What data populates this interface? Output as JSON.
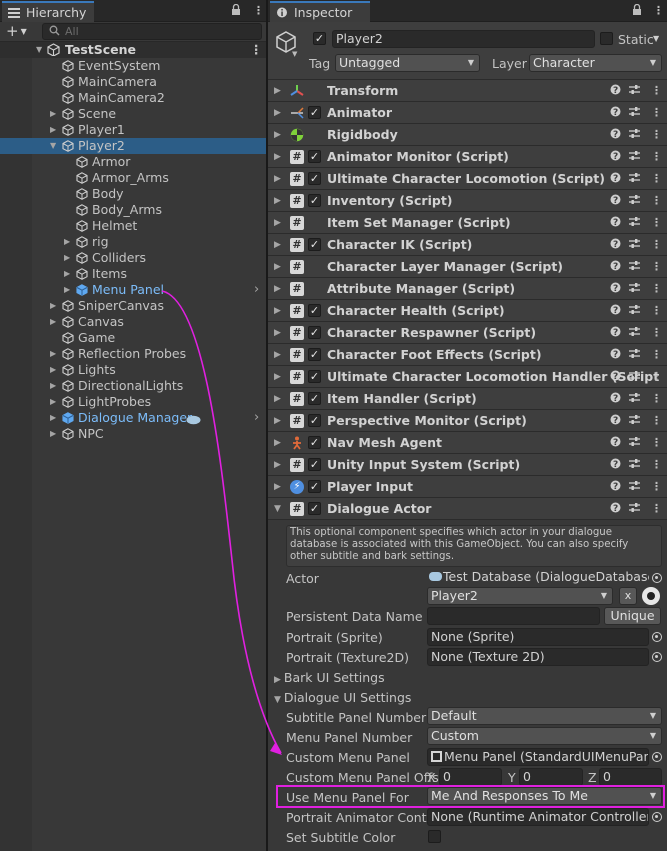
{
  "hierarchy": {
    "tab_title": "Hierarchy",
    "search_placeholder": "All",
    "scene": "TestScene",
    "items": [
      {
        "label": "EventSystem"
      },
      {
        "label": "MainCamera"
      },
      {
        "label": "MainCamera2"
      },
      {
        "label": "Scene"
      },
      {
        "label": "Player1"
      },
      {
        "label": "Player2"
      },
      {
        "label": "Armor"
      },
      {
        "label": "Armor_Arms"
      },
      {
        "label": "Body"
      },
      {
        "label": "Body_Arms"
      },
      {
        "label": "Helmet"
      },
      {
        "label": "rig"
      },
      {
        "label": "Colliders"
      },
      {
        "label": "Items"
      },
      {
        "label": "Menu Panel"
      },
      {
        "label": "SniperCanvas"
      },
      {
        "label": "Canvas"
      },
      {
        "label": "Game"
      },
      {
        "label": "Reflection Probes"
      },
      {
        "label": "Lights"
      },
      {
        "label": "DirectionalLights"
      },
      {
        "label": "LightProbes"
      },
      {
        "label": "Dialogue Manager"
      },
      {
        "label": "NPC"
      }
    ]
  },
  "inspector": {
    "tab_title": "Inspector",
    "object_name": "Player2",
    "static_label": "Static",
    "tag_label": "Tag",
    "tag_value": "Untagged",
    "layer_label": "Layer",
    "layer_value": "Character",
    "components": [
      {
        "name": "Transform",
        "icon": "transform-icon"
      },
      {
        "name": "Animator",
        "icon": "animator-icon"
      },
      {
        "name": "Rigidbody",
        "icon": "rigidbody-icon"
      },
      {
        "name": "Animator Monitor (Script)",
        "icon": "script-icon"
      },
      {
        "name": "Ultimate Character Locomotion (Script)",
        "icon": "script-icon"
      },
      {
        "name": "Inventory (Script)",
        "icon": "script-icon"
      },
      {
        "name": "Item Set Manager (Script)",
        "icon": "script-icon"
      },
      {
        "name": "Character IK (Script)",
        "icon": "script-icon"
      },
      {
        "name": "Character Layer Manager (Script)",
        "icon": "script-icon"
      },
      {
        "name": "Attribute Manager (Script)",
        "icon": "script-icon"
      },
      {
        "name": "Character Health (Script)",
        "icon": "script-icon"
      },
      {
        "name": "Character Respawner (Script)",
        "icon": "script-icon"
      },
      {
        "name": "Character Foot Effects (Script)",
        "icon": "script-icon"
      },
      {
        "name": "Ultimate Character Locomotion Handler (Script",
        "icon": "script-icon"
      },
      {
        "name": "Item Handler (Script)",
        "icon": "script-icon"
      },
      {
        "name": "Perspective Monitor (Script)",
        "icon": "script-icon"
      },
      {
        "name": "Nav Mesh Agent",
        "icon": "navmesh-icon"
      },
      {
        "name": "Unity Input System (Script)",
        "icon": "script-icon"
      },
      {
        "name": "Player Input",
        "icon": "player-input-icon"
      },
      {
        "name": "Dialogue Actor",
        "icon": "script-icon"
      }
    ],
    "dialogue_actor": {
      "help_text": "This optional component specifies which actor in your dialogue database is associated with this GameObject. You can also specify other subtitle and bark settings.",
      "actor_label": "Actor",
      "actor_db": "Test Database (DialogueDatabase)",
      "actor_value": "Player2",
      "clear_label": "x",
      "persistent_label": "Persistent Data Name",
      "persistent_value": "",
      "unique_label": "Unique",
      "portrait_sprite_label": "Portrait (Sprite)",
      "portrait_sprite_value": "None (Sprite)",
      "portrait_tex_label": "Portrait (Texture2D)",
      "portrait_tex_value": "None (Texture 2D)",
      "bark_label": "Bark UI Settings",
      "dialogue_ui_label": "Dialogue UI Settings",
      "subtitle_panel_label": "Subtitle Panel Number",
      "subtitle_panel_value": "Default",
      "menu_panel_label": "Menu Panel Number",
      "menu_panel_value": "Custom",
      "custom_menu_label": "Custom Menu Panel",
      "custom_menu_value": "Menu Panel (StandardUIMenuPanel",
      "offset_label": "Custom Menu Panel Offs",
      "offset_x_label": "X",
      "offset_x": "0",
      "offset_y_label": "Y",
      "offset_y": "0",
      "offset_z_label": "Z",
      "offset_z": "0",
      "use_menu_label": "Use Menu Panel For",
      "use_menu_value": "Me And Responses To Me",
      "portrait_anim_label": "Portrait Animator Control",
      "portrait_anim_value": "None (Runtime Animator Controller)",
      "subtitle_color_label": "Set Subtitle Color"
    }
  },
  "colors": {
    "selection": "#2c5d87",
    "annotation": "#e020e0",
    "prefab_blue": "#7cbcf9"
  }
}
